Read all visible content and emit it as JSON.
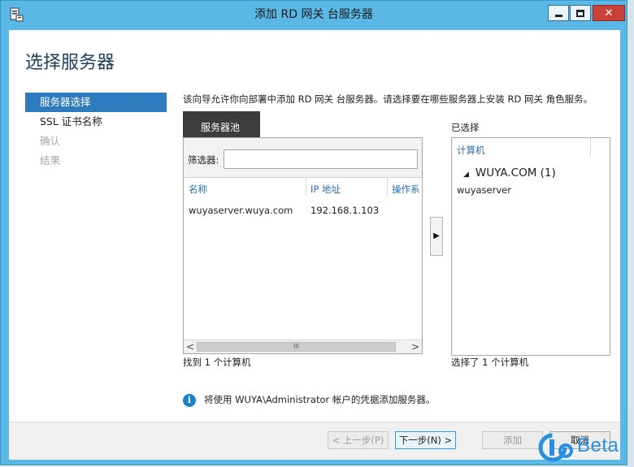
{
  "window": {
    "title": "添加 RD 网关 台服务器",
    "close_glyph": "✕"
  },
  "heading": "选择服务器",
  "nav": {
    "items": [
      {
        "label": "服务器选择",
        "state": "active"
      },
      {
        "label": "SSL 证书名称",
        "state": "normal"
      },
      {
        "label": "确认",
        "state": "disabled"
      },
      {
        "label": "结果",
        "state": "disabled"
      }
    ]
  },
  "description": "该向导允许你向部署中添加 RD 网关 台服务器。请选择要在哪些服务器上安装 RD 网关 角色服务。",
  "server_pool": {
    "tab_label": "服务器池",
    "filter_label": "筛选器:",
    "filter_value": "",
    "columns": [
      "名称",
      "IP 地址",
      "操作系"
    ],
    "rows": [
      {
        "name": "wuyaserver.wuya.com",
        "ip": "192.168.1.103",
        "os": ""
      }
    ],
    "scroll_left": "<",
    "scroll_thumb": "III",
    "scroll_right": ">",
    "found_text": "找到 1 个计算机"
  },
  "move_button": "▶",
  "selected": {
    "label": "已选择",
    "column": "计算机",
    "group": "WUYA.COM (1)",
    "group_toggle": "◢",
    "items": [
      "wuyaserver"
    ],
    "count_text": "选择了 1 个计算机"
  },
  "info": {
    "icon_glyph": "i",
    "text": "将使用 WUYA\\Administrator 帐户的凭据添加服务器。"
  },
  "buttons": {
    "prev": "< 上一步(P)",
    "next": "下一步(N) >",
    "add": "添加",
    "cancel": "取消"
  },
  "watermark": {
    "text": "Beta"
  },
  "colors": {
    "titlebar": "#5bb8e6",
    "nav_active": "#2e7bbd",
    "link_blue": "#2e6fa8",
    "heading": "#1e3e5a"
  }
}
